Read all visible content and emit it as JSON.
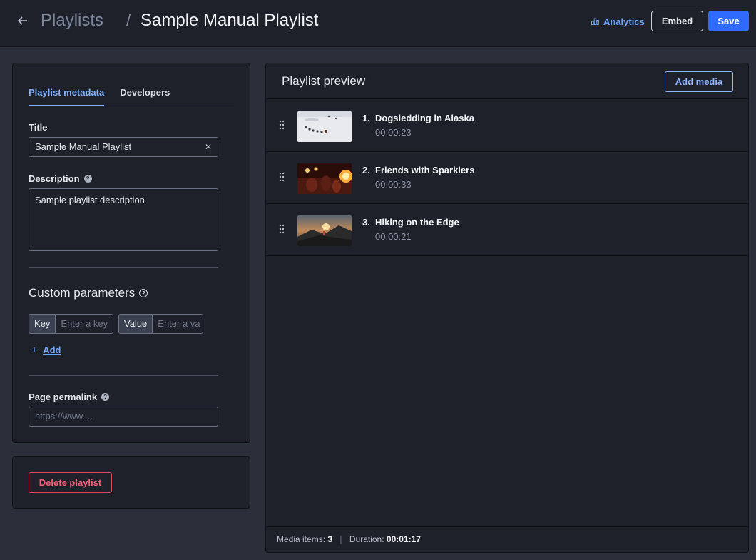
{
  "header": {
    "back_icon": "arrow-left-icon",
    "breadcrumb_parent": "Playlists",
    "breadcrumb_separator": "/",
    "title": "Sample Manual Playlist",
    "analytics_label": "Analytics",
    "embed_label": "Embed",
    "save_label": "Save"
  },
  "metadata": {
    "tabs": [
      {
        "label": "Playlist metadata",
        "active": true
      },
      {
        "label": "Developers",
        "active": false
      }
    ],
    "title_label": "Title",
    "title_value": "Sample Manual Playlist",
    "description_label": "Description",
    "description_value": "Sample playlist description",
    "custom_params_label": "Custom parameters",
    "key_tag": "Key",
    "key_placeholder": "Enter a key",
    "value_tag": "Value",
    "value_placeholder": "Enter a va",
    "add_label": "Add",
    "permalink_label": "Page permalink",
    "permalink_placeholder": "https://www...."
  },
  "danger": {
    "delete_label": "Delete playlist"
  },
  "preview": {
    "title": "Playlist preview",
    "add_media_label": "Add media",
    "items": [
      {
        "num": "1.",
        "title": "Dogsledding in Alaska",
        "duration": "00:00:23"
      },
      {
        "num": "2.",
        "title": "Friends with Sparklers",
        "duration": "00:00:33"
      },
      {
        "num": "3.",
        "title": "Hiking on the Edge",
        "duration": "00:00:21"
      }
    ],
    "footer": {
      "items_label": "Media items:",
      "items_count": "3",
      "separator": "|",
      "duration_label": "Duration:",
      "duration_value": "00:01:17"
    }
  },
  "colors": {
    "accent": "#2f6bff",
    "link": "#6fa6ff",
    "danger": "#e0445f"
  }
}
